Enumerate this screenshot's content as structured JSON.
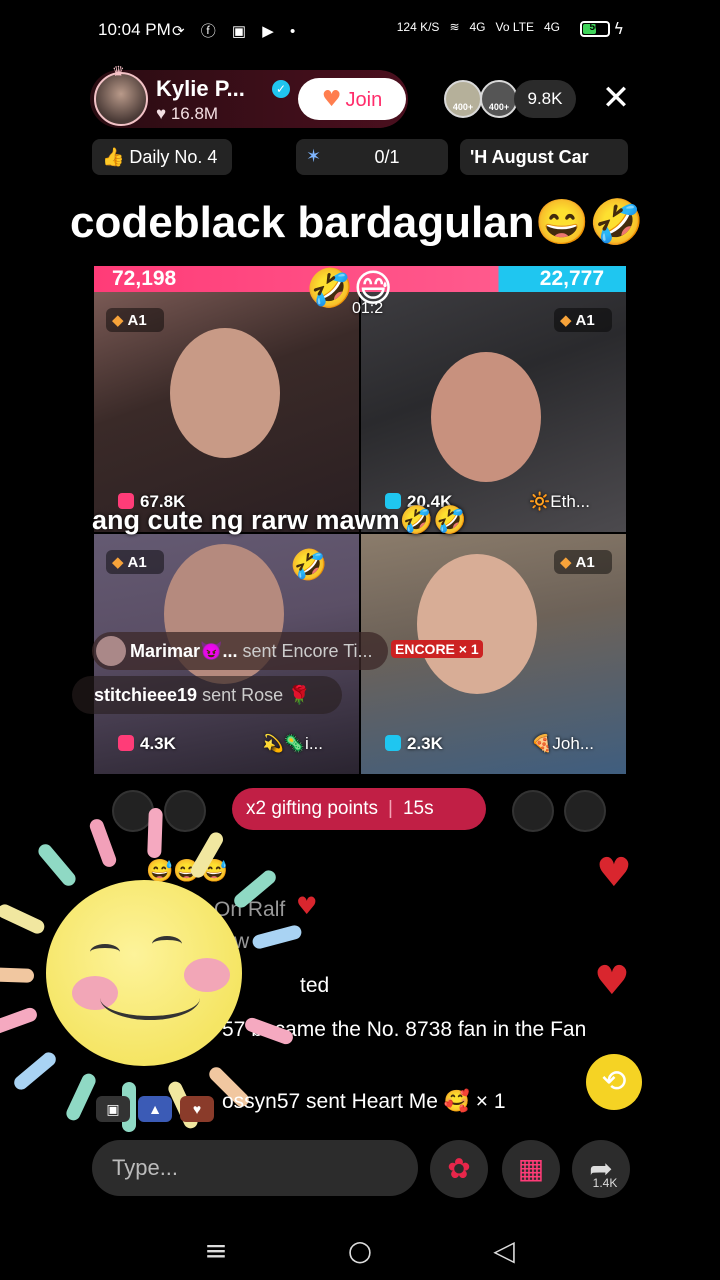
{
  "status_bar": {
    "time": "10:04 PM",
    "icons": "⟳ ⓕ ▣ ▶ •",
    "net_speed": "124 K/S",
    "signal_1": "4G",
    "signal_2": "Vo LTE",
    "signal_3": "4G",
    "battery": "56",
    "battery_level_percent": 56
  },
  "host": {
    "name": "Kylie P...",
    "likes": "♥ 16.8M",
    "join_label": "Join",
    "viewer_badge_1": "400+",
    "viewer_badge_2": "400+",
    "viewer_count": "9.8K",
    "close_label": "✕"
  },
  "pills": {
    "daily": "👍 Daily No. 4",
    "goal": "0/1",
    "event": "'H August Car"
  },
  "title": "codeblack bardagulan😄🤣",
  "battle": {
    "score_left": "72,198",
    "score_right": "22,777",
    "left_share_fraction": 0.76,
    "timer": "01:2",
    "top_emojis": "🤣😅",
    "tiles": [
      {
        "badge": "A1",
        "count": "67.8K",
        "user": ""
      },
      {
        "badge": "A1",
        "count": "20.4K",
        "user": "🔆Eth..."
      },
      {
        "badge": "A1",
        "count": "4.3K",
        "user": "💫🦠i..."
      },
      {
        "badge": "A1",
        "count": "2.3K",
        "user": "🍕Joh..."
      }
    ],
    "tile3_emoji": "🤣",
    "tile4_gift": "ENCORE × 1"
  },
  "overlay_caption": "ang cute ng rarw mawm🤣🤣",
  "gift_notes": [
    {
      "user": "Marimar😈...",
      "text": "sent Encore Ti..."
    },
    {
      "user": "stitchieee19",
      "text": "sent Rose 🌹"
    }
  ],
  "gifting_banner": {
    "label": "x2 gifting points",
    "timer": "15s"
  },
  "chat": {
    "emoji_row": "😅😅😅",
    "line_1": "On Ralf",
    "line_2": "w",
    "line_3": "ted",
    "line_4": "57 became the No. 8738 fan in the Fan",
    "gift_line": "ossyn57 sent Heart Me 🥰 × 1"
  },
  "bottom": {
    "input_placeholder": "Type...",
    "share_count": "1.4K"
  },
  "colors": {
    "accent_pink": "#ff3c78",
    "accent_blue": "#1fc6f0",
    "gifting_red": "#c11f45",
    "share_yellow": "#f5d324"
  }
}
